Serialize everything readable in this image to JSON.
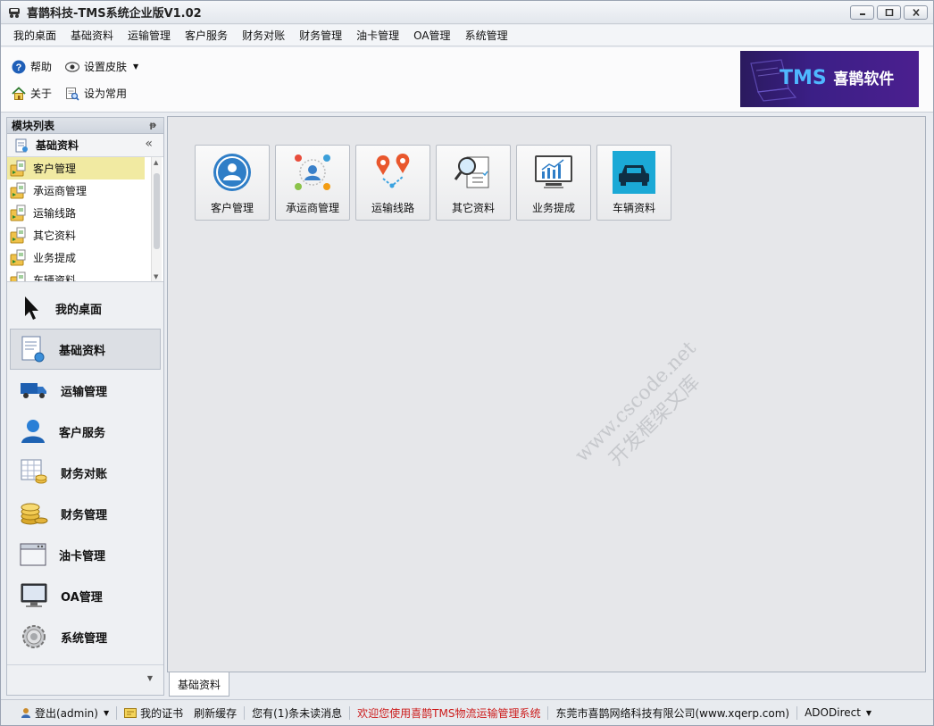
{
  "window": {
    "title": "喜鹊科技-TMS系统企业版V1.02"
  },
  "menu": {
    "items": [
      "我的桌面",
      "基础资料",
      "运输管理",
      "客户服务",
      "财务对账",
      "财务管理",
      "油卡管理",
      "OA管理",
      "系统管理"
    ]
  },
  "toolbar": {
    "help": "帮助",
    "skin": "设置皮肤",
    "about": "关于",
    "set_common": "设为常用"
  },
  "banner": {
    "brand_tms": "TMS",
    "brand_name": "喜鹊软件"
  },
  "left_panel": {
    "title": "模块列表",
    "group": "基础资料",
    "tree_items": [
      "客户管理",
      "承运商管理",
      "运输线路",
      "其它资料",
      "业务提成",
      "车辆资料"
    ],
    "nav": [
      "我的桌面",
      "基础资料",
      "运输管理",
      "客户服务",
      "财务对账",
      "财务管理",
      "油卡管理",
      "OA管理",
      "系统管理"
    ]
  },
  "tiles": [
    "客户管理",
    "承运商管理",
    "运输线路",
    "其它资料",
    "业务提成",
    "车辆资料"
  ],
  "watermark": {
    "line1": "www.cscode.net",
    "line2": "开发框架文库"
  },
  "doc_tab": "基础资料",
  "status": {
    "logout": "登出(admin)",
    "cert": "我的证书",
    "refresh": "刷新缓存",
    "messages": "您有(1)条未读消息",
    "welcome": "欢迎您使用喜鹊TMS物流运输管理系统",
    "company": "东莞市喜鹊网络科技有限公司(www.xqerp.com)",
    "db": "ADODirect"
  },
  "colors": {
    "selected_tree": "#f1eaa2",
    "welcome_text": "#cc1a1a",
    "banner_bg": "#3b1f86"
  }
}
